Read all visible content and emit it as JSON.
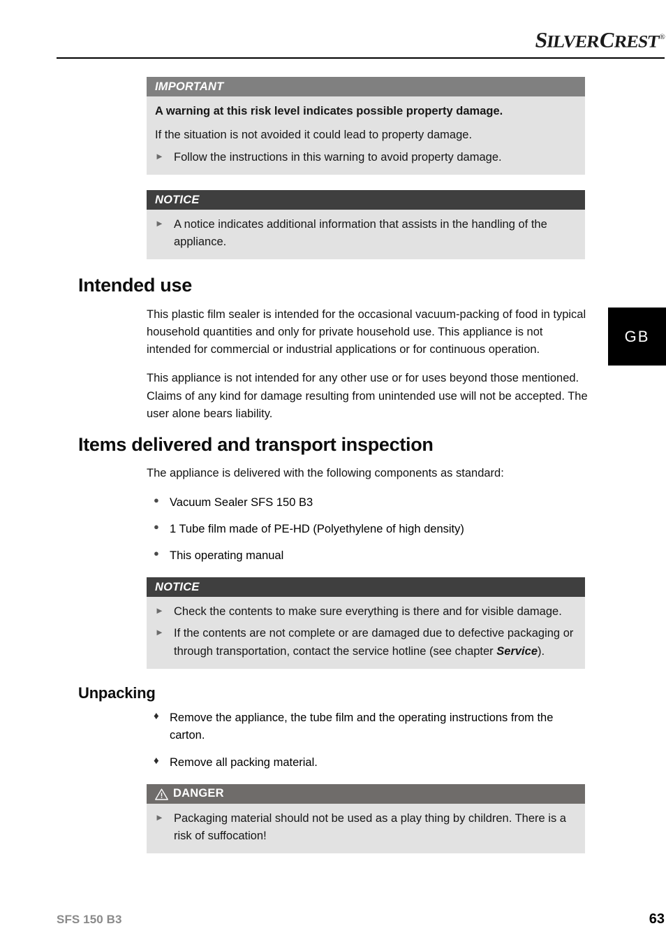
{
  "header": {
    "brand_part1": "S",
    "brand_part2": "ILVER",
    "brand_part3": "C",
    "brand_part4": "REST",
    "brand_registered": "®",
    "brand_full": "SILVERCREST®"
  },
  "language_tab": {
    "label": "GB"
  },
  "boxes": {
    "important": {
      "title": "IMPORTANT",
      "lead": "A warning at this risk level indicates possible property damage.",
      "paragraph": "If the situation is not avoided it could lead to property damage.",
      "items": [
        "Follow the instructions in this warning to avoid property damage."
      ],
      "arrow_glyph": "►",
      "head_color": "#808080",
      "body_color": "#e2e2e2"
    },
    "notice_1": {
      "title": "NOTICE",
      "items": [
        "A notice indicates additional information that assists in the handling of the appliance."
      ],
      "arrow_glyph": "►",
      "head_color": "#3f3f3f",
      "body_color": "#e2e2e2"
    },
    "notice_2": {
      "title": "NOTICE",
      "items": [
        "Check the contents to make sure everything is there and for visible damage."
      ],
      "item_2_prefix": "If the contents are not complete or are damaged due to defective packaging or through transportation, contact the service hotline (see chapter ",
      "item_2_emphasis": "Service",
      "item_2_suffix": ").",
      "arrow_glyph": "►",
      "head_color": "#3f3f3f",
      "body_color": "#e2e2e2"
    },
    "danger": {
      "title": "DANGER",
      "icon": "warning-triangle-icon",
      "items": [
        "Packaging material should not be used as a play thing by children. There is a risk of suffocation!"
      ],
      "arrow_glyph": "►",
      "head_color": "#6f6c6a",
      "body_color": "#e2e2e2"
    }
  },
  "sections": {
    "intended_use": {
      "heading": "Intended use",
      "paragraphs": [
        "This plastic film sealer is intended for the occasional vacuum-packing of food in typical household quantities and only for private household use. This appliance is not intended for commercial or industrial applications or for continuous operation.",
        "This appliance is not intended for any other use or for uses beyond those mentioned. Claims of any kind for damage resulting from unintended use will not be accepted. The user alone bears liability."
      ]
    },
    "items_delivered": {
      "heading": "Items delivered and transport inspection",
      "intro": "The appliance is delivered with the following components as standard:",
      "bullet_glyph": "●",
      "list": [
        "Vacuum Sealer SFS 150 B3",
        "1 Tube film made of PE-HD (Polyethylene of high density)",
        "This operating manual"
      ]
    },
    "unpacking": {
      "heading": "Unpacking",
      "bullet_glyph": "♦",
      "list": [
        "Remove the appliance, the tube film and the operating instructions from the carton.",
        "Remove all packing material."
      ]
    }
  },
  "footer": {
    "model": "SFS 150 B3",
    "page_number": "63"
  }
}
